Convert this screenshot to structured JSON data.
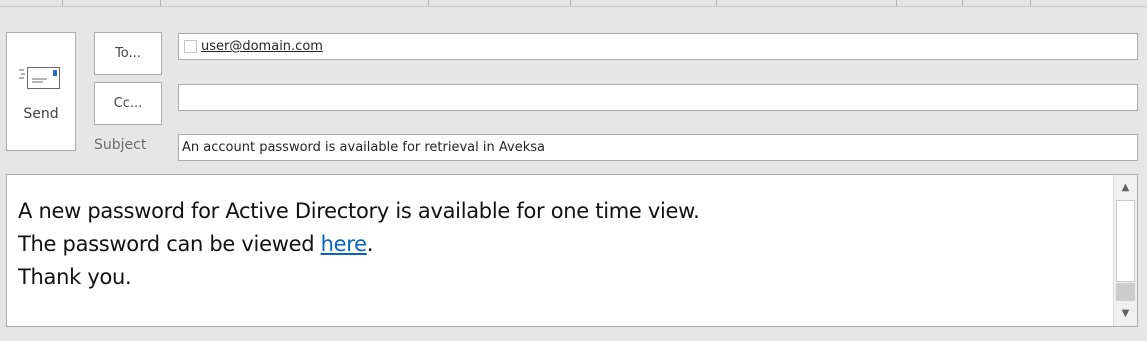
{
  "compose": {
    "send_label": "Send",
    "to_button_label": "To...",
    "cc_button_label": "Cc...",
    "subject_label": "Subject",
    "to_value": "user@domain.com",
    "cc_value": "",
    "subject_value": "An account password is available for retrieval in Aveksa"
  },
  "message": {
    "line1": "A new password for Active Directory is available for one time view.",
    "line2_prefix": "The password can be viewed ",
    "line2_link": "here",
    "line2_suffix": ".",
    "line3": "Thank you."
  },
  "icons": {
    "send": "send-envelope-icon",
    "scroll_up": "scroll-up-arrow-icon",
    "scroll_down": "scroll-down-arrow-icon"
  },
  "colors": {
    "link": "#0563c1",
    "background": "#e6e6e6"
  }
}
